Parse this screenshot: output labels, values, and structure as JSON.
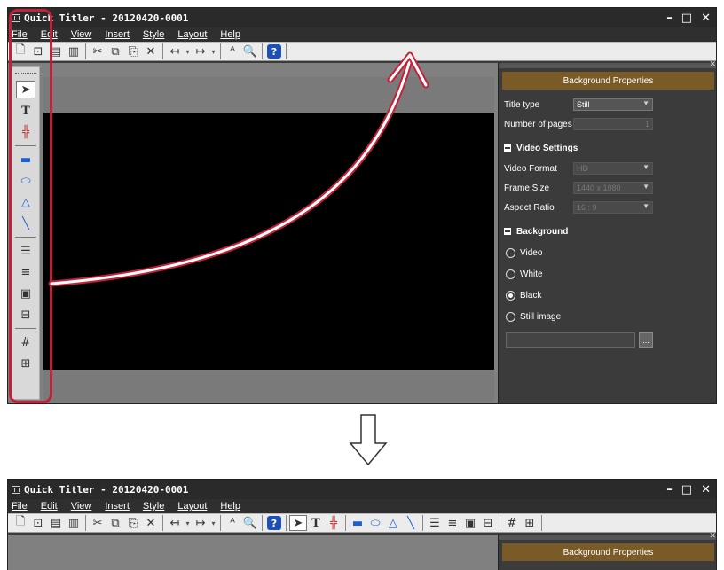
{
  "window": {
    "title": "Quick Titler - 20120420-0001",
    "controls": [
      "–",
      "□",
      "✕"
    ]
  },
  "menu": [
    "File",
    "Edit",
    "View",
    "Insert",
    "Style",
    "Layout",
    "Help"
  ],
  "panel": {
    "header": "Background Properties",
    "title_type_label": "Title type",
    "title_type_value": "Still",
    "pages_label": "Number of pages",
    "pages_value": "1",
    "video_section": "Video Settings",
    "video_format_label": "Video Format",
    "video_format_value": "HD",
    "frame_size_label": "Frame Size",
    "frame_size_value": "1440 x 1080",
    "aspect_label": "Aspect Ratio",
    "aspect_value": "16 : 9",
    "background_section": "Background",
    "radio_video": "Video",
    "radio_white": "White",
    "radio_black": "Black",
    "radio_still": "Still image",
    "browse": "...",
    "selected_background": "Black"
  },
  "colors": {
    "highlight": "#c4203a",
    "panel_header": "#7a5a26",
    "help_button": "#1d4fb8"
  }
}
